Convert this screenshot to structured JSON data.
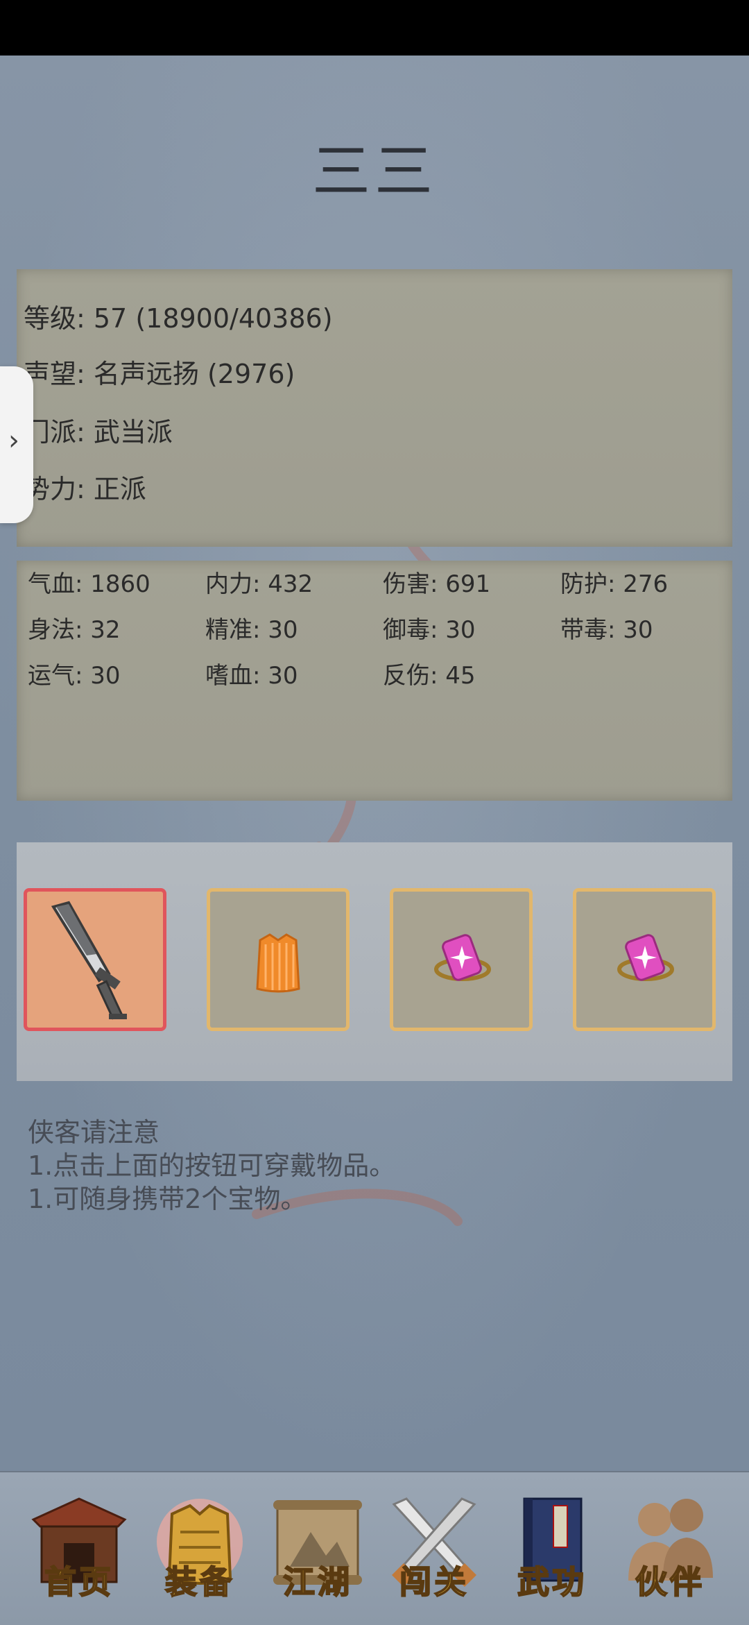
{
  "character": {
    "name": "三三",
    "level_line": "等级: 57 (18900/40386)",
    "fame_line": "声望: 名声远扬 (2976)",
    "sect_line": "门派: 武当派",
    "faction_line": "势力:  正派"
  },
  "stats": [
    {
      "label": "气血: 1860"
    },
    {
      "label": "内力: 432"
    },
    {
      "label": "伤害: 691"
    },
    {
      "label": "防护: 276"
    },
    {
      "label": "身法: 32"
    },
    {
      "label": "精准: 30"
    },
    {
      "label": "御毒: 30"
    },
    {
      "label": "带毒: 30"
    },
    {
      "label": "运气: 30"
    },
    {
      "label": "嗜血: 30"
    },
    {
      "label": "反伤: 45"
    }
  ],
  "equipment": [
    {
      "item": "sword-icon",
      "selected": true
    },
    {
      "item": "armor-icon",
      "selected": false
    },
    {
      "item": "treasure-ring-icon",
      "selected": false
    },
    {
      "item": "treasure-ring-icon",
      "selected": false
    }
  ],
  "notes": {
    "title": "侠客请注意",
    "line1": "1.点击上面的按钮可穿戴物品。",
    "line2": "1.可随身携带2个宝物。"
  },
  "side_tab": {
    "icon": "chevron-right-icon",
    "glyph": "›"
  },
  "nav": [
    {
      "label": "首页",
      "icon": "house-icon"
    },
    {
      "label": "装备",
      "icon": "armor-icon",
      "active": true
    },
    {
      "label": "江湖",
      "icon": "scroll-map-icon"
    },
    {
      "label": "闯关",
      "icon": "crossed-swords-icon"
    },
    {
      "label": "武功",
      "icon": "book-icon"
    },
    {
      "label": "伙伴",
      "icon": "people-icon"
    }
  ],
  "colors": {
    "background": "#7f8fa1",
    "panel": "#a3a294",
    "slot_border": "#e2b76c",
    "slot_selected_border": "#e0555c",
    "nav_label": "#f3c23a"
  }
}
